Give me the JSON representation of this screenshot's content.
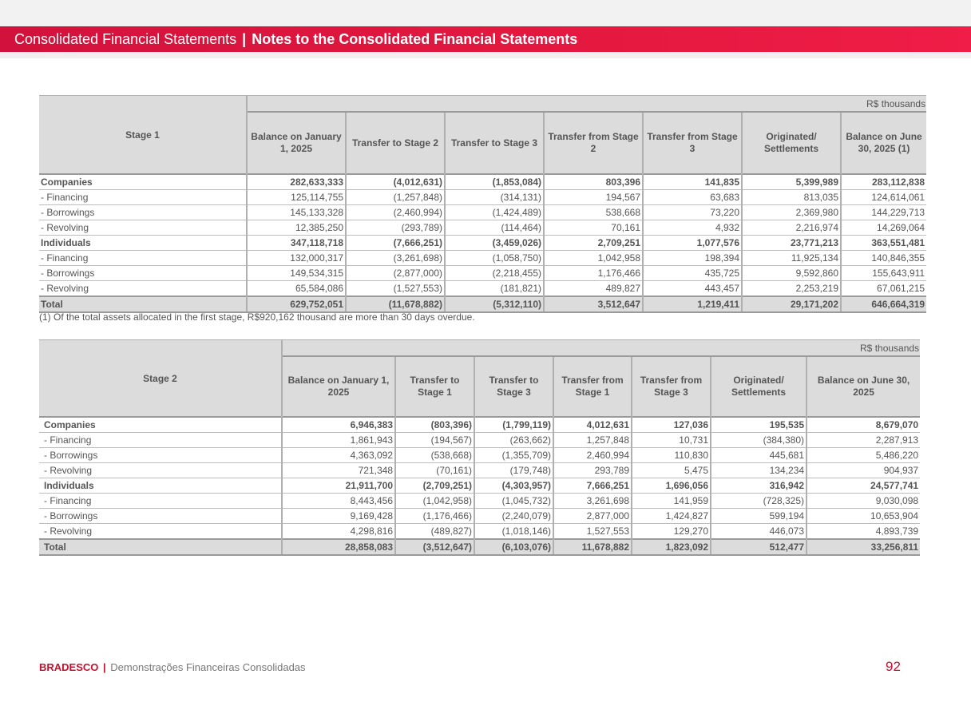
{
  "header": {
    "section": "Consolidated Financial Statements",
    "separator": "|",
    "note_title": "Notes to the Consolidated Financial Statements"
  },
  "table1": {
    "unit_label": "R$ thousands",
    "stage_label": "Stage 1",
    "columns": [
      "Balance on January 1, 2025",
      "Transfer to Stage 2",
      "Transfer to Stage 3",
      "Transfer from Stage 2",
      "Transfer from Stage 3",
      "Originated/ Settlements",
      "Balance on June 30, 2025 (1)"
    ],
    "rows": [
      {
        "label": "Companies",
        "values": [
          "282,633,333",
          "(4,012,631)",
          "(1,853,084)",
          "803,396",
          "141,835",
          "5,399,989",
          "283,112,838"
        ]
      },
      {
        "label": "- Financing",
        "values": [
          "125,114,755",
          "(1,257,848)",
          "(314,131)",
          "194,567",
          "63,683",
          "813,035",
          "124,614,061"
        ]
      },
      {
        "label": "- Borrowings",
        "values": [
          "145,133,328",
          "(2,460,994)",
          "(1,424,489)",
          "538,668",
          "73,220",
          "2,369,980",
          "144,229,713"
        ]
      },
      {
        "label": "- Revolving",
        "values": [
          "12,385,250",
          "(293,789)",
          "(114,464)",
          "70,161",
          "4,932",
          "2,216,974",
          "14,269,064"
        ]
      },
      {
        "label": "Individuals",
        "values": [
          "347,118,718",
          "(7,666,251)",
          "(3,459,026)",
          "2,709,251",
          "1,077,576",
          "23,771,213",
          "363,551,481"
        ]
      },
      {
        "label": "- Financing",
        "values": [
          "132,000,317",
          "(3,261,698)",
          "(1,058,750)",
          "1,042,958",
          "198,394",
          "11,925,134",
          "140,846,355"
        ]
      },
      {
        "label": "- Borrowings",
        "values": [
          "149,534,315",
          "(2,877,000)",
          "(2,218,455)",
          "1,176,466",
          "435,725",
          "9,592,860",
          "155,643,911"
        ]
      },
      {
        "label": "- Revolving",
        "values": [
          "65,584,086",
          "(1,527,553)",
          "(181,821)",
          "489,827",
          "443,457",
          "2,253,219",
          "67,061,215"
        ]
      },
      {
        "label": "Total",
        "values": [
          "629,752,051",
          "(11,678,882)",
          "(5,312,110)",
          "3,512,647",
          "1,219,411",
          "29,171,202",
          "646,664,319"
        ]
      }
    ],
    "footnote": "(1) Of the total assets allocated in the first stage, R$920,162 thousand are more than 30 days overdue."
  },
  "table2": {
    "unit_label": "R$ thousands",
    "stage_label": "Stage 2",
    "columns": [
      "Balance on January 1, 2025",
      "Transfer to Stage 1",
      "Transfer to Stage 3",
      "Transfer from Stage 1",
      "Transfer from Stage 3",
      "Originated/ Settlements",
      "Balance on June 30, 2025"
    ],
    "rows": [
      {
        "label": "Companies",
        "values": [
          "6,946,383",
          "(803,396)",
          "(1,799,119)",
          "4,012,631",
          "127,036",
          "195,535",
          "8,679,070"
        ]
      },
      {
        "label": "- Financing",
        "values": [
          "1,861,943",
          "(194,567)",
          "(263,662)",
          "1,257,848",
          "10,731",
          "(384,380)",
          "2,287,913"
        ]
      },
      {
        "label": "- Borrowings",
        "values": [
          "4,363,092",
          "(538,668)",
          "(1,355,709)",
          "2,460,994",
          "110,830",
          "445,681",
          "5,486,220"
        ]
      },
      {
        "label": "- Revolving",
        "values": [
          "721,348",
          "(70,161)",
          "(179,748)",
          "293,789",
          "5,475",
          "134,234",
          "904,937"
        ]
      },
      {
        "label": "Individuals",
        "values": [
          "21,911,700",
          "(2,709,251)",
          "(4,303,957)",
          "7,666,251",
          "1,696,056",
          "316,942",
          "24,577,741"
        ]
      },
      {
        "label": "- Financing",
        "values": [
          "8,443,456",
          "(1,042,958)",
          "(1,045,732)",
          "3,261,698",
          "141,959",
          "(728,325)",
          "9,030,098"
        ]
      },
      {
        "label": "- Borrowings",
        "values": [
          "9,169,428",
          "(1,176,466)",
          "(2,240,079)",
          "2,877,000",
          "1,424,827",
          "599,194",
          "10,653,904"
        ]
      },
      {
        "label": "- Revolving",
        "values": [
          "4,298,816",
          "(489,827)",
          "(1,018,146)",
          "1,527,553",
          "129,270",
          "446,073",
          "4,893,739"
        ]
      },
      {
        "label": "Total",
        "values": [
          "28,858,083",
          "(3,512,647)",
          "(6,103,076)",
          "11,678,882",
          "1,823,092",
          "512,477",
          "33,256,811"
        ]
      }
    ]
  },
  "footer": {
    "brand": "BRADESCO",
    "separator": "|",
    "subtitle": "Demonstrações Financeiras Consolidadas",
    "page_number": "92"
  }
}
